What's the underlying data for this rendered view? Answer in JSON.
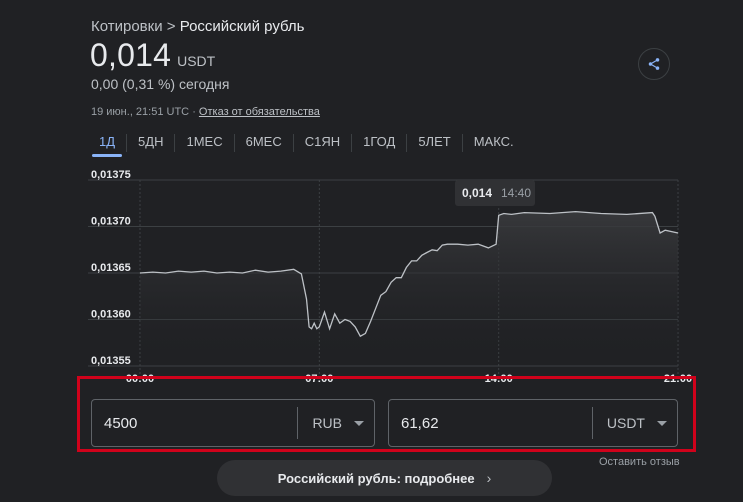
{
  "breadcrumb": {
    "parent": "Котировки",
    "separator": ">",
    "current": "Российский рубль"
  },
  "price": {
    "value": "0,014",
    "unit": "USDT"
  },
  "change": "0,00 (0,31 %) сегодня",
  "meta": {
    "timestamp": "19 июн., 21:51 UTC",
    "dot": "·",
    "disclaimer": "Отказ от обязательства"
  },
  "share": {
    "icon": "share-icon"
  },
  "tabs": [
    {
      "label": "1Д",
      "active": true
    },
    {
      "label": "5ДН"
    },
    {
      "label": "1МЕС"
    },
    {
      "label": "6МЕС"
    },
    {
      "label": "С1ЯН"
    },
    {
      "label": "1ГОД"
    },
    {
      "label": "5ЛЕТ"
    },
    {
      "label": "МАКС."
    }
  ],
  "chart_data": {
    "type": "line",
    "y_ticks": [
      "0,01375",
      "0,01370",
      "0,01365",
      "0,01360",
      "0,01355"
    ],
    "x_ticks": [
      "00:00",
      "07:00",
      "14:00",
      "21:00"
    ],
    "ylim": [
      0.01355,
      0.01375
    ],
    "xlim": [
      0,
      21
    ],
    "tooltip": {
      "value": "0,014",
      "time": "14:40"
    },
    "colors": {
      "line": "#bdc1c6",
      "grid": "#3c4043",
      "fill": "#3a3b3e"
    },
    "series": [
      {
        "x": [
          0.0,
          0.5,
          1.0,
          1.5,
          2.0,
          2.5,
          3.0,
          3.5,
          4.0,
          4.5,
          5.0,
          5.5,
          6.0,
          6.3,
          6.5,
          6.6,
          6.7,
          6.8,
          6.9,
          7.0,
          7.2,
          7.4,
          7.6,
          7.8,
          8.0,
          8.2,
          8.4,
          8.6,
          8.8,
          9.0,
          9.2,
          9.4,
          9.6,
          9.8,
          10.0,
          10.2,
          10.4,
          10.6,
          10.8,
          11.0,
          11.2,
          11.4,
          11.6,
          11.8,
          12.0,
          12.4,
          12.8,
          13.2,
          13.6,
          13.9,
          14.0,
          14.2,
          14.5,
          15.0,
          16.0,
          17.0,
          18.0,
          19.0,
          20.0,
          20.1,
          20.3,
          20.5,
          21.0
        ],
        "y": [
          0.01365,
          0.013651,
          0.01365,
          0.013652,
          0.013651,
          0.013652,
          0.01365,
          0.013651,
          0.01365,
          0.013653,
          0.013651,
          0.013652,
          0.013654,
          0.013649,
          0.013622,
          0.013592,
          0.01359,
          0.013596,
          0.01359,
          0.013592,
          0.013608,
          0.01359,
          0.013606,
          0.013596,
          0.0136,
          0.013598,
          0.013592,
          0.013582,
          0.013585,
          0.013598,
          0.013612,
          0.013626,
          0.01363,
          0.01364,
          0.013645,
          0.013645,
          0.013656,
          0.013663,
          0.013663,
          0.013669,
          0.013672,
          0.013675,
          0.013674,
          0.01368,
          0.013681,
          0.013681,
          0.01368,
          0.013681,
          0.013677,
          0.013681,
          0.013712,
          0.013714,
          0.013713,
          0.013715,
          0.013714,
          0.013716,
          0.013714,
          0.013713,
          0.013715,
          0.013711,
          0.013693,
          0.013696,
          0.013693
        ]
      }
    ]
  },
  "converter": {
    "from": {
      "value": "4500",
      "unit": "RUB"
    },
    "to": {
      "value": "61,62",
      "unit": "USDT"
    }
  },
  "feedback": "Оставить отзыв",
  "more": {
    "label": "Российский рубль: подробнее",
    "chevron": "›"
  }
}
